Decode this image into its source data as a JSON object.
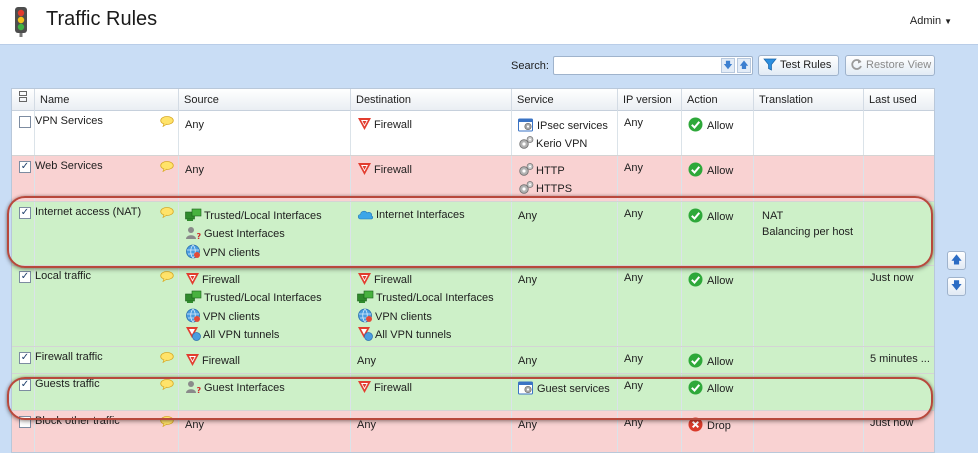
{
  "app": {
    "title": "Traffic Rules",
    "user_menu": "Admin"
  },
  "toolbar": {
    "search_label": "Search:",
    "search_value": "",
    "test_rules": "Test Rules",
    "restore_view": "Restore View"
  },
  "columns": [
    "Name",
    "Source",
    "Destination",
    "Service",
    "IP version",
    "Action",
    "Translation",
    "Last used"
  ],
  "rows": [
    {
      "name": "VPN Services",
      "checked": false,
      "color": "white",
      "source": "Any",
      "destination": [
        {
          "icon": "firewall",
          "label": "Firewall"
        }
      ],
      "service": [
        {
          "icon": "service-group",
          "label": "IPsec services"
        },
        {
          "icon": "gear",
          "label": "Kerio VPN"
        }
      ],
      "ip_version": "Any",
      "action": "Allow",
      "translation": [],
      "last_used": ""
    },
    {
      "name": "Web Services",
      "checked": true,
      "color": "red",
      "source": "Any",
      "destination": [
        {
          "icon": "firewall",
          "label": "Firewall"
        }
      ],
      "service": [
        {
          "icon": "gear",
          "label": "HTTP"
        },
        {
          "icon": "gear",
          "label": "HTTPS"
        }
      ],
      "ip_version": "Any",
      "action": "Allow",
      "translation": [],
      "last_used": ""
    },
    {
      "name": "Internet access (NAT)",
      "checked": true,
      "color": "green",
      "source": [
        {
          "icon": "trusted",
          "label": "Trusted/Local Interfaces"
        },
        {
          "icon": "guest",
          "label": "Guest Interfaces"
        },
        {
          "icon": "vpn",
          "label": "VPN clients"
        }
      ],
      "destination": [
        {
          "icon": "internet",
          "label": "Internet Interfaces"
        }
      ],
      "service": "Any",
      "ip_version": "Any",
      "action": "Allow",
      "translation": [
        "NAT",
        "Balancing per host"
      ],
      "last_used": ""
    },
    {
      "name": "Local traffic",
      "checked": true,
      "color": "green",
      "source": [
        {
          "icon": "firewall",
          "label": "Firewall"
        },
        {
          "icon": "trusted",
          "label": "Trusted/Local Interfaces"
        },
        {
          "icon": "vpn",
          "label": "VPN clients"
        },
        {
          "icon": "tunnel",
          "label": "All VPN tunnels"
        }
      ],
      "destination": [
        {
          "icon": "firewall",
          "label": "Firewall"
        },
        {
          "icon": "trusted",
          "label": "Trusted/Local Interfaces"
        },
        {
          "icon": "vpn",
          "label": "VPN clients"
        },
        {
          "icon": "tunnel",
          "label": "All VPN tunnels"
        }
      ],
      "service": "Any",
      "ip_version": "Any",
      "action": "Allow",
      "translation": [],
      "last_used": "Just now"
    },
    {
      "name": "Firewall traffic",
      "checked": true,
      "color": "green",
      "source": [
        {
          "icon": "firewall",
          "label": "Firewall"
        }
      ],
      "destination": "Any",
      "service": "Any",
      "ip_version": "Any",
      "action": "Allow",
      "translation": [],
      "last_used": "5 minutes ..."
    },
    {
      "name": "Guests traffic",
      "checked": true,
      "color": "green",
      "source": [
        {
          "icon": "guest",
          "label": "Guest Interfaces"
        }
      ],
      "destination": [
        {
          "icon": "firewall",
          "label": "Firewall"
        }
      ],
      "service": [
        {
          "icon": "service-group",
          "label": "Guest services"
        }
      ],
      "ip_version": "Any",
      "action": "Allow",
      "translation": [],
      "last_used": ""
    },
    {
      "name": "Block other traffic",
      "checked": false,
      "color": "red",
      "source": "Any",
      "destination": "Any",
      "service": "Any",
      "ip_version": "Any",
      "action": "Drop",
      "translation": [],
      "last_used": "Just now"
    }
  ],
  "colors": {
    "row_green": "#cdf0c8",
    "row_red": "#f9d2d2",
    "highlight_ring": "#b8483c",
    "allow_green": "#2ea83a",
    "drop_red": "#d93a2a"
  }
}
